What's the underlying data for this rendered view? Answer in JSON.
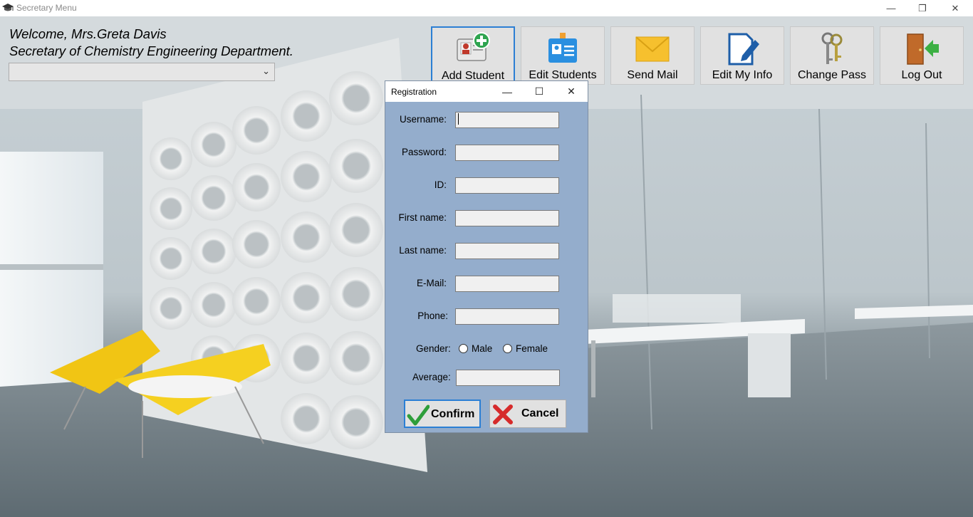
{
  "window": {
    "title": "Secretary Menu",
    "controls": {
      "minimize": "—",
      "restore": "❐",
      "close": "✕"
    }
  },
  "welcome": {
    "line1": "Welcome, Mrs.Greta Davis",
    "line2": "Secretary of Chemistry Engineering Department.",
    "dropdown_value": "",
    "dropdown_chevron": "⌄"
  },
  "toolbar": {
    "items": [
      {
        "label": "Add Student",
        "icon": "add-student-icon",
        "active": true
      },
      {
        "label": "Edit Students",
        "icon": "id-badge-icon"
      },
      {
        "label": "Send Mail",
        "icon": "envelope-icon"
      },
      {
        "label": "Edit My Info",
        "icon": "edit-document-icon"
      },
      {
        "label": "Change Pass",
        "icon": "keys-icon"
      },
      {
        "label": "Log Out",
        "icon": "exit-door-icon"
      }
    ]
  },
  "dialog": {
    "title": "Registration",
    "controls": {
      "minimize": "—",
      "maximize": "☐",
      "close": "✕"
    },
    "fields": [
      {
        "label": "Username:",
        "value": ""
      },
      {
        "label": "Password:",
        "value": ""
      },
      {
        "label": "ID:",
        "value": ""
      },
      {
        "label": "First name:",
        "value": ""
      },
      {
        "label": "Last name:",
        "value": ""
      },
      {
        "label": "E-Mail:",
        "value": ""
      },
      {
        "label": "Phone:",
        "value": ""
      }
    ],
    "gender": {
      "label": "Gender:",
      "options": [
        "Male",
        "Female"
      ],
      "selected": null
    },
    "average": {
      "label": "Average:",
      "value": ""
    },
    "confirm_label": "Confirm",
    "cancel_label": "Cancel"
  },
  "colors": {
    "dialog_bg": "#94adcc",
    "accent": "#2b7fd4",
    "tile_bg": "#e1e1e1"
  }
}
